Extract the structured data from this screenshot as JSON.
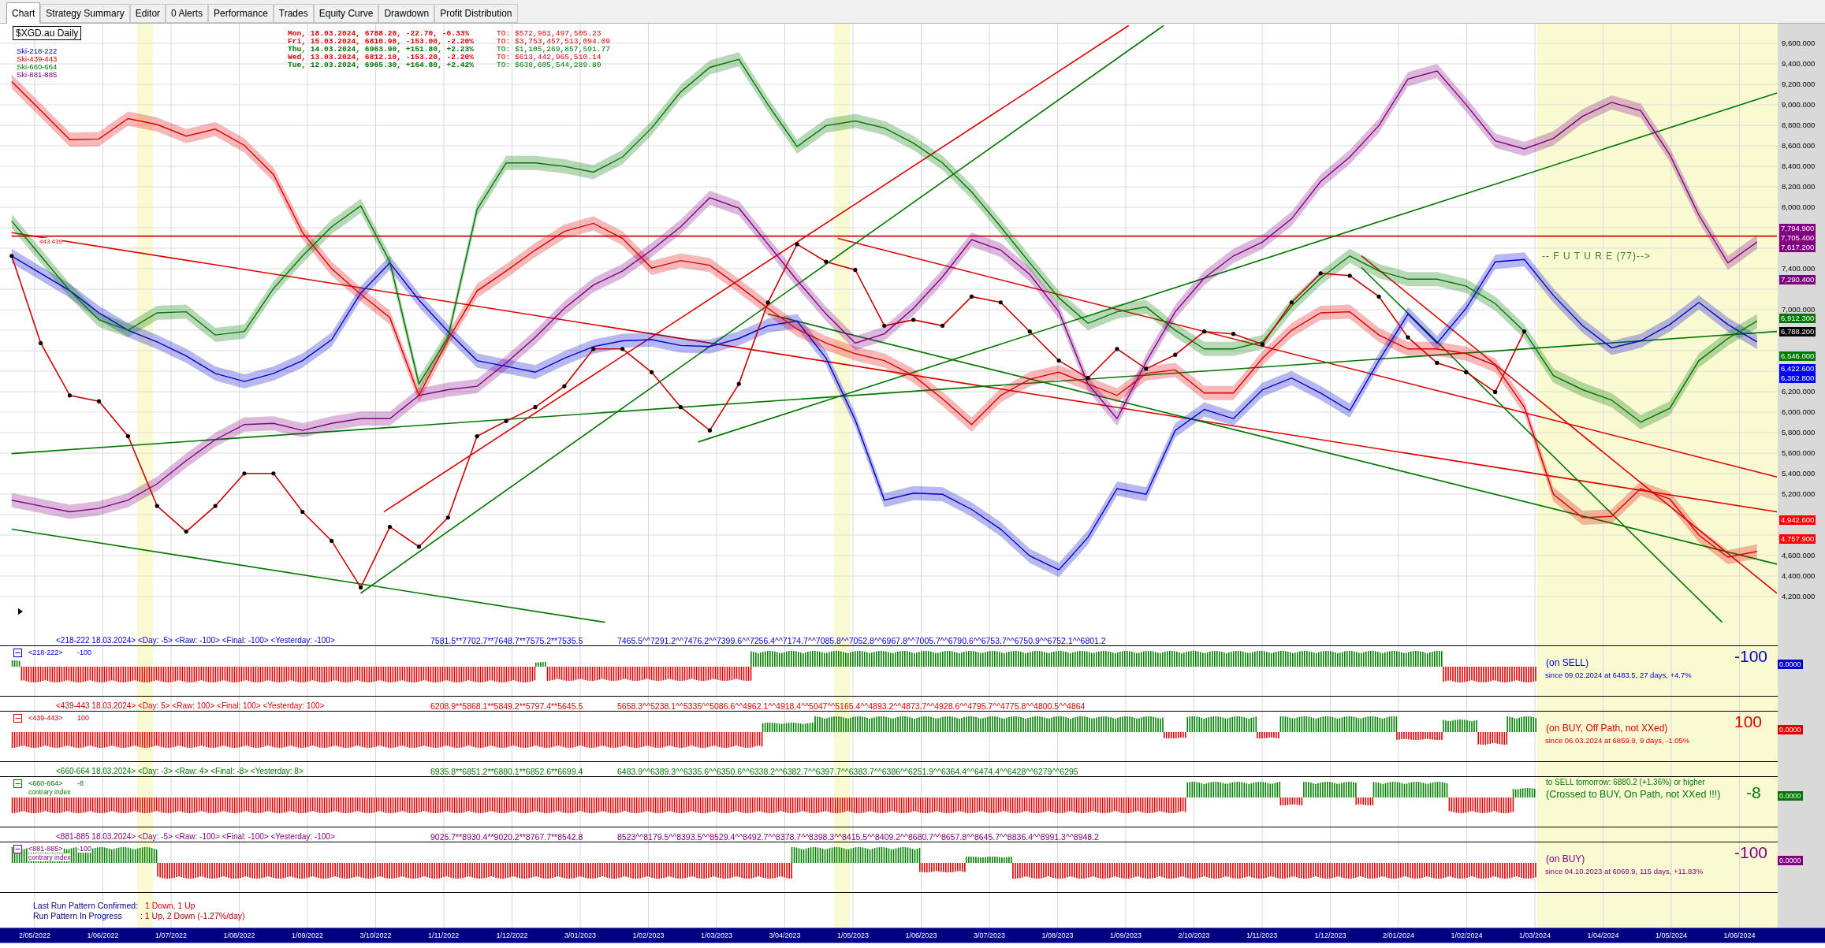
{
  "tabs": [
    {
      "label": "Chart",
      "selected": true
    },
    {
      "label": "Strategy Summary",
      "selected": false
    },
    {
      "label": "Editor",
      "selected": false
    },
    {
      "label": "0 Alerts",
      "selected": false
    },
    {
      "label": "Performance",
      "selected": false
    },
    {
      "label": "Trades",
      "selected": false
    },
    {
      "label": "Equity Curve",
      "selected": false
    },
    {
      "label": "Drawdown",
      "selected": false
    },
    {
      "label": "Profit Distribution",
      "selected": false
    }
  ],
  "chart": {
    "symbol": "$XGD.au Daily",
    "quotes": [
      {
        "text": "Mon, 18.03.2024, 6788.20, -22.70, -0.33%",
        "turnover": "TO: $572,981,497,505.23",
        "color": "#dd0000"
      },
      {
        "text": "Fri, 15.03.2024, 6810.90, -153.00, -2.20%",
        "turnover": "TO: $3,753,457,513,094.09",
        "color": "#dd0000"
      },
      {
        "text": "Thu, 14.03.2024, 6963.90, +151.80, +2.23%",
        "turnover": "TO: $1,105,269,857,591.77",
        "color": "#007700"
      },
      {
        "text": "Wed, 13.03.2024, 6812.10, -153.20, -2.20%",
        "turnover": "TO: $613,442,965,510.14",
        "color": "#dd0000"
      },
      {
        "text": "Tue, 12.03.2024, 6965.30, +164.80, +2.42%",
        "turnover": "TO: $638,605,544,289.80",
        "color": "#007700"
      }
    ],
    "line_label": "443 439",
    "future_label": "-- F U T U R E (77)-->",
    "chart_data": {
      "type": "line",
      "ylim": [
        4200,
        9600
      ],
      "grid": true,
      "yticks": [
        {
          "value": 9600,
          "label": "9,600.000"
        },
        {
          "value": 9400,
          "label": "9,400.000"
        },
        {
          "value": 9200,
          "label": "9,200.000"
        },
        {
          "value": 9000,
          "label": "9,000.000"
        },
        {
          "value": 8800,
          "label": "8,800.000"
        },
        {
          "value": 8600,
          "label": "8,600.000"
        },
        {
          "value": 8400,
          "label": "8,400.000"
        },
        {
          "value": 8200,
          "label": "8,200.000"
        },
        {
          "value": 8000,
          "label": "8,000.000"
        },
        {
          "value": 7400,
          "label": "7,400.000"
        },
        {
          "value": 7000,
          "label": "7,000.000"
        },
        {
          "value": 6200,
          "label": "6,200.000"
        },
        {
          "value": 6000,
          "label": "6,000.000"
        },
        {
          "value": 5800,
          "label": "5,800.000"
        },
        {
          "value": 5600,
          "label": "5,600.000"
        },
        {
          "value": 5400,
          "label": "5,400.000"
        },
        {
          "value": 5200,
          "label": "5,200.000"
        },
        {
          "value": 4600,
          "label": "4,600.000"
        },
        {
          "value": 4400,
          "label": "4,400.000"
        },
        {
          "value": 4200,
          "label": "4,200.000"
        }
      ],
      "series": [
        {
          "color": "#cc0000",
          "values": [
            7525,
            6674,
            6163,
            6106,
            5765,
            5084,
            4834,
            5084,
            5402,
            5402,
            5027,
            4743,
            4289,
            4880,
            4687,
            4971,
            5765,
            5913,
            6049,
            6253,
            6617,
            6617,
            6390,
            6049,
            5822,
            6276,
            7071,
            7639,
            7468,
            7389,
            6844,
            6901,
            6844,
            7128,
            7071,
            6787,
            6503,
            6333,
            6617,
            6424,
            6560,
            6787,
            6764,
            6662,
            7071,
            7355,
            7332,
            7128,
            6730,
            6481,
            6390,
            6197,
            6788,
            null,
            null,
            null,
            null,
            null,
            null,
            null,
            null
          ]
        },
        {
          "name": "Ski-218-222",
          "color": "#0000cc",
          "values": [
            7525,
            7355,
            7185,
            6969,
            6799,
            6685,
            6549,
            6378,
            6299,
            6378,
            6503,
            6708,
            7162,
            7457,
            7094,
            6787,
            6503,
            6447,
            6390,
            6526,
            6640,
            6696,
            6708,
            6651,
            6640,
            6719,
            6844,
            6889,
            6526,
            5924,
            5141,
            5209,
            5198,
            5050,
            4857,
            4596,
            4460,
            4778,
            5254,
            5198,
            5822,
            6026,
            5936,
            6219,
            6333,
            6186,
            6015,
            6503,
            6957,
            6674,
            7014,
            7468,
            7491,
            7139,
            6844,
            6628,
            6696,
            6855,
            7071,
            6855,
            6685
          ]
        },
        {
          "name": "Ski-439-443",
          "color": "#dd0000",
          "values": [
            9228,
            8944,
            8660,
            8666,
            8865,
            8808,
            8695,
            8763,
            8604,
            8320,
            7752,
            7400,
            7150,
            6923,
            6163,
            6708,
            7184,
            7378,
            7582,
            7764,
            7843,
            7695,
            7407,
            7480,
            7434,
            7230,
            7014,
            6810,
            6674,
            6571,
            6503,
            6356,
            6129,
            5879,
            6163,
            6322,
            6390,
            6276,
            6163,
            6378,
            6412,
            6186,
            6186,
            6526,
            6799,
            6969,
            6980,
            6753,
            6617,
            6617,
            6571,
            6458,
            6049,
            5198,
            4970,
            4982,
            5254,
            5152,
            4800,
            4585,
            4641
          ]
        },
        {
          "name": "Ski-660-664",
          "color": "#007700",
          "values": [
            7866,
            7525,
            7185,
            6901,
            6799,
            6969,
            6980,
            6753,
            6787,
            7207,
            7525,
            7809,
            8013,
            7468,
            6276,
            6730,
            7979,
            8433,
            8433,
            8399,
            8343,
            8490,
            8774,
            9126,
            9365,
            9444,
            9001,
            8592,
            8797,
            8842,
            8774,
            8626,
            8433,
            8150,
            7809,
            7457,
            7116,
            6867,
            6980,
            7026,
            6799,
            6617,
            6617,
            6685,
            7037,
            7310,
            7525,
            7378,
            7298,
            7298,
            7230,
            7060,
            6787,
            6356,
            6219,
            6117,
            5902,
            6038,
            6503,
            6719,
            6889
          ]
        },
        {
          "name": "Ski-881-885",
          "color": "#800080",
          "values": [
            5141,
            5084,
            5027,
            5061,
            5141,
            5300,
            5527,
            5731,
            5879,
            5890,
            5822,
            5890,
            5936,
            5936,
            6163,
            6219,
            6253,
            6481,
            6730,
            7014,
            7241,
            7378,
            7582,
            7809,
            8093,
            7991,
            7639,
            7287,
            6957,
            6674,
            6765,
            7014,
            7321,
            7684,
            7582,
            7344,
            6980,
            6276,
            5936,
            6492,
            6980,
            7310,
            7525,
            7661,
            7888,
            8252,
            8490,
            8797,
            9251,
            9330,
            9001,
            8649,
            8570,
            8672,
            8888,
            9024,
            8944,
            8513,
            7923,
            7457,
            7661
          ]
        }
      ]
    },
    "price_tags": [
      {
        "label": "7,794.900",
        "color": "#800080"
      },
      {
        "label": "7,705.400",
        "color": "#800080"
      },
      {
        "label": "7,617.200",
        "color": "#800080"
      },
      {
        "label": "7,290.400",
        "color": "#800080"
      },
      {
        "label": "6,912.300",
        "color": "#007700"
      },
      {
        "label": "6,788.200",
        "color": "#000000"
      },
      {
        "label": "6,546.000",
        "color": "#007700"
      },
      {
        "label": "6,422.600",
        "color": "#0000ff"
      },
      {
        "label": "6,362.800",
        "color": "#0000ff"
      },
      {
        "label": "4,942.600",
        "color": "#ff0000"
      },
      {
        "label": "4,757.900",
        "color": "#ff0000"
      }
    ]
  },
  "panels": [
    {
      "header": "<218-222  18.03.2024>  <Day: -5>  <Raw: -100>  <Final: -100>  <Yesterday: -100>",
      "values_recent": "7581.5**7702.7**7648.7**7575.2**7535.5",
      "values_earlier": "7465.5^^7291.2^^7476.2^^7399.6^^7256.4^^7174.7^^7085.8^^7052.8^^6967.8^^7005.7^^6790.6^^6753.7^^6750.9^^6752.1^^6801.2",
      "name": "<218-222>",
      "signal": "-100",
      "status": "(on SELL)",
      "since": "since 09.02.2024 at 6483.5, 27 days, +4.7%",
      "score": "-100",
      "box_value": "0.0000",
      "color": "#0000cc"
    },
    {
      "header": "<439-443  18.03.2024>  <Day: 5>  <Raw: 100>  <Final: 100>  <Yesterday: 100>",
      "values_recent": "6208.9**5868.1**5849.2**5797.4**5645.5",
      "values_earlier": "5658.3^^5238.1^^5335^^5086.6^^4962.1^^4918.4^^5047^^5165.4^^4893.2^^4873.7^^4928.6^^4795.7^^4775.8^^4800.5^^4864",
      "name": "<439-443>",
      "signal": "100",
      "status": "(on BUY, Off Path, not XXed)",
      "since": "since 06.03.2024 at 6859.9, 9 days, -1.05%",
      "score": "100",
      "box_value": "0.0000",
      "color": "#dd0000"
    },
    {
      "header": "<660-664  18.03.2024>  <Day: -3>  <Raw: 4>  <Final: -8>  <Yesterday: 8>",
      "values_recent": "6935.8**6851.2**6880.1**6852.6**6699.4",
      "values_earlier": "6483.9^^6389.3^^6335.6^^6350.6^^6338.2^^6382.7^^6397.7^^6383.7^^6386^^6251.9^^6364.4^^6474.4^^6428^^6279^^6295",
      "name": "<660-664>",
      "signal": "-8",
      "note": "contrary index",
      "advice": "to SELL tomorrow: 6880.2 (+1.36%) or higher",
      "status": "(Crossed to BUY, On Path, not XXed !!!)",
      "score": "-8",
      "box_value": "0.0000",
      "color": "#007700"
    },
    {
      "header": "<881-885  18.03.2024>  <Day: -5>  <Raw: -100>  <Final: -100>  <Yesterday: -100>",
      "values_recent": "9025.7**8930.4**9020.2**8767.7**8542.8",
      "values_earlier": "8523^^8179.5^^8393.5^^8529.4^^8492.7^^8378.7^^8398.3^^8415.5^^8409.2^^8680.7^^8657.8^^8645.7^^8836.4^^8991.3^^8948.2",
      "name": "<881-885>",
      "signal": "-100",
      "note": "contrary index",
      "status": "(on BUY)",
      "since": "since 04.10.2023 at 6069.9, 115 days, +11.83%",
      "score": "-100",
      "box_value": "0.0000",
      "color": "#800080"
    }
  ],
  "footer": {
    "confirmed_label": "Last Run Pattern Confirmed:",
    "confirmed_value": "1 Down, 1 Up",
    "progress_label": "Run Pattern In Progress",
    "progress_value": ": 1 Up, 2 Down  (-1.27%/day)"
  },
  "dates": [
    "2/05/2022",
    "1/06/2022",
    "1/07/2022",
    "1/08/2022",
    "1/09/2022",
    "3/10/2022",
    "1/11/2022",
    "1/12/2022",
    "3/01/2023",
    "1/02/2023",
    "1/03/2023",
    "3/04/2023",
    "1/05/2023",
    "1/06/2023",
    "3/07/2023",
    "1/08/2023",
    "1/09/2023",
    "2/10/2023",
    "1/11/2023",
    "1/12/2023",
    "2/01/2024",
    "1/02/2024",
    "1/03/2024",
    "1/04/2024",
    "1/05/2024",
    "1/06/2024"
  ]
}
